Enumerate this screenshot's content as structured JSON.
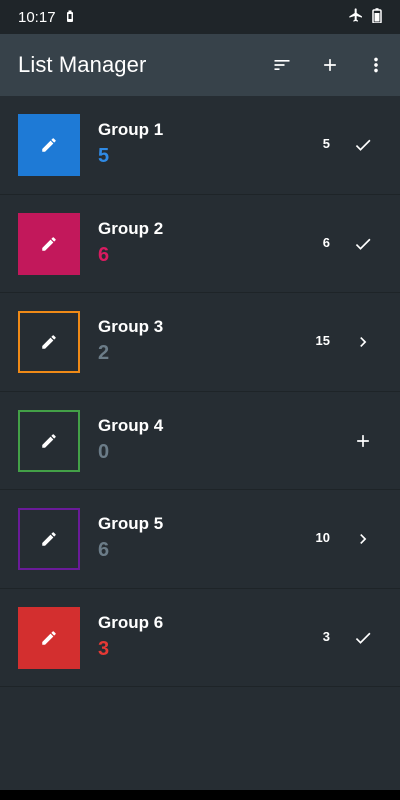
{
  "status_bar": {
    "time": "10:17",
    "left_icon": "battery-saver-icon",
    "right_icons": [
      "airplane-icon",
      "battery-icon"
    ]
  },
  "app_bar": {
    "title": "List Manager",
    "actions": [
      "sort-icon",
      "add-icon",
      "more-vert-icon"
    ]
  },
  "groups": [
    {
      "name": "Group 1",
      "count": "5",
      "badge": "5",
      "color": "#1e7ad6",
      "style": "filled",
      "count_color": "#2f8ae5",
      "action": "check-icon"
    },
    {
      "name": "Group 2",
      "count": "6",
      "badge": "6",
      "color": "#c2185b",
      "style": "filled",
      "count_color": "#d81b60",
      "action": "check-icon"
    },
    {
      "name": "Group 3",
      "count": "2",
      "badge": "15",
      "color": "#ef8a17",
      "style": "outline",
      "count_color": "#6b7c88",
      "action": "chevron-right-icon"
    },
    {
      "name": "Group 4",
      "count": "0",
      "badge": "",
      "color": "#43a047",
      "style": "outline",
      "count_color": "#6b7c88",
      "action": "add-icon"
    },
    {
      "name": "Group 5",
      "count": "6",
      "badge": "10",
      "color": "#6a1b9a",
      "style": "outline",
      "count_color": "#6b7c88",
      "action": "chevron-right-icon"
    },
    {
      "name": "Group 6",
      "count": "3",
      "badge": "3",
      "color": "#d32f2f",
      "style": "filled",
      "count_color": "#e53935",
      "action": "check-icon"
    }
  ]
}
